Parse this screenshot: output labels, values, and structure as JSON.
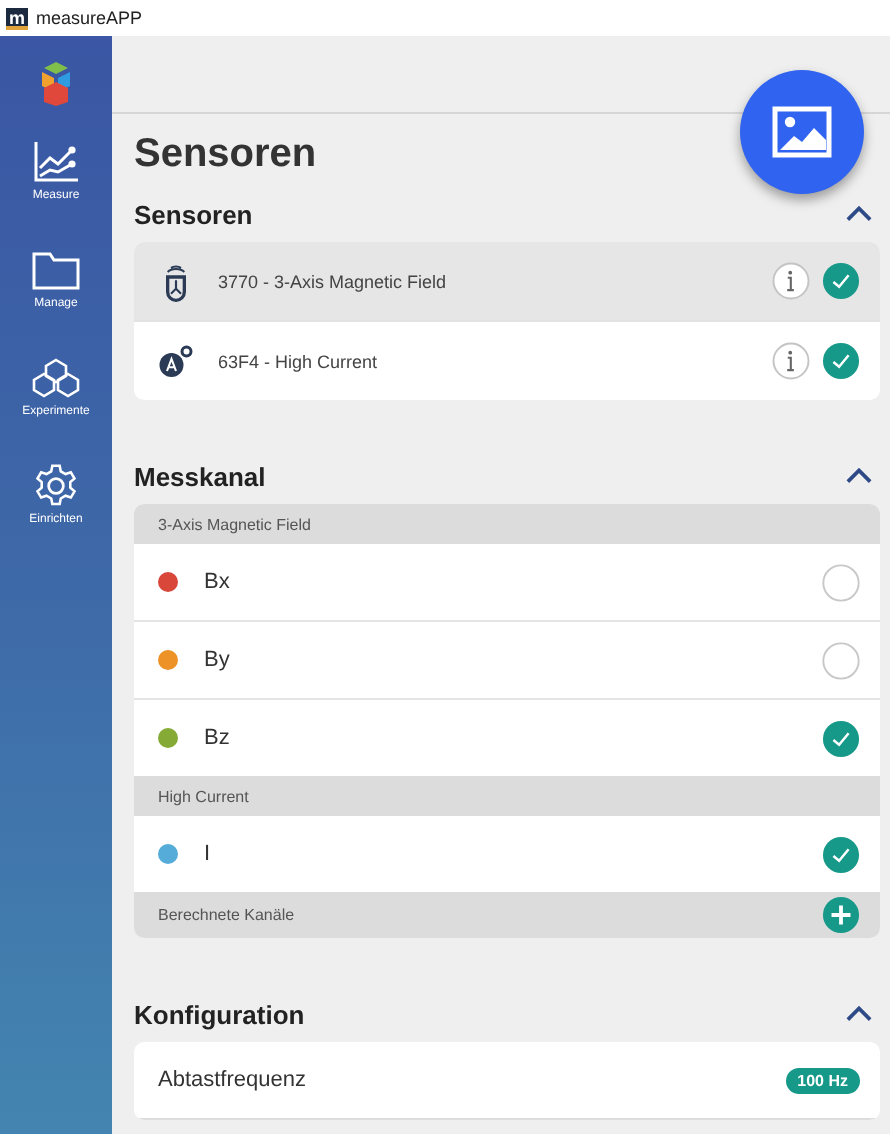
{
  "window": {
    "icon_letter": "m",
    "title": "measureAPP"
  },
  "sidebar": {
    "items": [
      {
        "label": "Measure",
        "kind": "chart"
      },
      {
        "label": "Manage",
        "kind": "folder"
      },
      {
        "label": "Experimente",
        "kind": "cubes"
      },
      {
        "label": "Einrichten",
        "kind": "gear"
      }
    ]
  },
  "page_title": "Sensoren",
  "sections": [
    {
      "title": "Sensoren",
      "expanded": true,
      "kind": "sensors",
      "sensors": [
        {
          "name": "3770 - 3-Axis Magnetic Field",
          "kind": "magnet",
          "selected": true,
          "checked": true
        },
        {
          "name": "63F4 - High Current",
          "kind": "ampere",
          "selected": false,
          "checked": true
        }
      ]
    },
    {
      "title": "Messkanal",
      "expanded": true,
      "kind": "channels",
      "groups": [
        {
          "name": "3-Axis Magnetic Field",
          "channels": [
            {
              "name": "Bx",
              "color": "#d9473b",
              "checked": false
            },
            {
              "name": "By",
              "color": "#ec9226",
              "checked": false
            },
            {
              "name": "Bz",
              "color": "#86aa36",
              "checked": true
            }
          ]
        },
        {
          "name": "High Current",
          "channels": [
            {
              "name": "I",
              "color": "#56acd9",
              "checked": true
            }
          ]
        }
      ],
      "computed": {
        "label": "Berechnete Kanäle"
      }
    },
    {
      "title": "Konfiguration",
      "expanded": true,
      "kind": "config",
      "settings": [
        {
          "label": "Abtastfrequenz",
          "value": "100 Hz"
        }
      ]
    }
  ]
}
